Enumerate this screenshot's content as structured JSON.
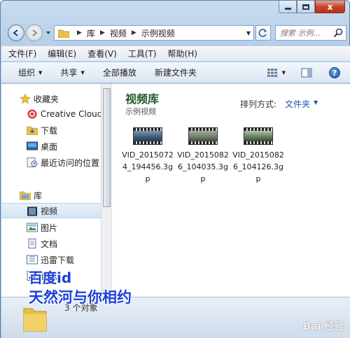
{
  "window": {
    "caption": {
      "min": "",
      "max": "",
      "close": "x"
    }
  },
  "address": {
    "segments": [
      "库",
      "视频",
      "示例视频"
    ],
    "search_placeholder": "搜索 示例..."
  },
  "menu": [
    "文件(F)",
    "编辑(E)",
    "查看(V)",
    "工具(T)",
    "帮助(H)"
  ],
  "toolbar": {
    "organize": "组织",
    "share": "共享",
    "play_all": "全部播放",
    "new_folder": "新建文件夹"
  },
  "sidebar": {
    "favorites_header": "收藏夹",
    "favorites": [
      "Creative Cloud",
      "下载",
      "桌面",
      "最近访问的位置"
    ],
    "library_header": "库",
    "libraries": [
      "视频",
      "图片",
      "文档",
      "迅雷下载",
      "音乐"
    ]
  },
  "content": {
    "title": "视频库",
    "subtitle": "示例视频",
    "arrange_label": "排列方式:",
    "arrange_value": "文件夹",
    "files": [
      {
        "name": "VID_20150724_194456.3gp",
        "thumb_color": "#3b5a7a"
      },
      {
        "name": "VID_20150826_104035.3gp",
        "thumb_color": "#6d7a6a"
      },
      {
        "name": "VID_20150826_104126.3gp",
        "thumb_color": "#5f7a5a"
      }
    ]
  },
  "status": {
    "text": "3 个对象"
  },
  "watermark": {
    "line1": "百度id",
    "line2": "天然河与你相约",
    "logo": "Bai 经验"
  }
}
